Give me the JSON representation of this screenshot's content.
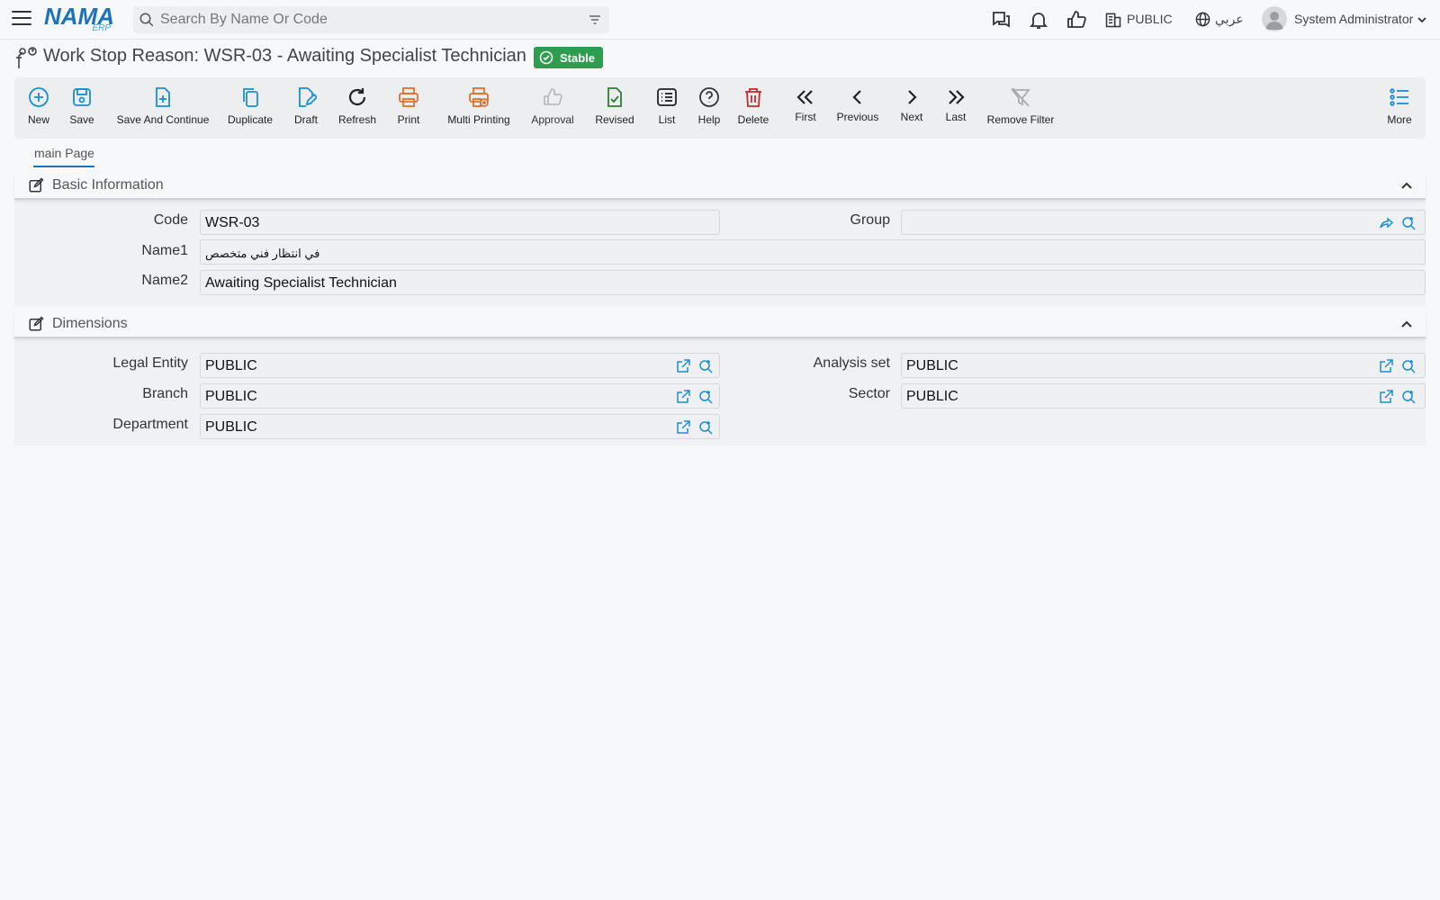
{
  "topbar": {
    "logo_main": "NAMA",
    "logo_sub": "ERP",
    "search_placeholder": "Search By Name Or Code",
    "company": "PUBLIC",
    "language": "عربي",
    "user": "System Administrator"
  },
  "header": {
    "title": "Work Stop Reason: WSR-03 - Awaiting Specialist Technician",
    "status": "Stable",
    "status_color": "#2e9d4f"
  },
  "toolbar": {
    "new": "New",
    "save": "Save",
    "save_continue": "Save And Continue",
    "duplicate": "Duplicate",
    "draft": "Draft",
    "refresh": "Refresh",
    "print": "Print",
    "multi_printing": "Multi Printing",
    "approval": "Approval",
    "revised": "Revised",
    "list": "List",
    "help": "Help",
    "delete": "Delete",
    "first": "First",
    "previous": "Previous",
    "next": "Next",
    "last": "Last",
    "remove_filter": "Remove Filter",
    "more": "More"
  },
  "tabs": {
    "main": "main Page"
  },
  "basic_info": {
    "title": "Basic Information",
    "code_label": "Code",
    "code_value": "WSR-03",
    "group_label": "Group",
    "group_value": "",
    "name1_label": "Name1",
    "name1_value": "في انتظار فني متخصص",
    "name2_label": "Name2",
    "name2_value": "Awaiting Specialist Technician"
  },
  "dimensions": {
    "title": "Dimensions",
    "legal_entity_label": "Legal Entity",
    "legal_entity_value": "PUBLIC",
    "analysis_set_label": "Analysis set",
    "analysis_set_value": "PUBLIC",
    "branch_label": "Branch",
    "branch_value": "PUBLIC",
    "sector_label": "Sector",
    "sector_value": "PUBLIC",
    "department_label": "Department",
    "department_value": "PUBLIC"
  },
  "colors": {
    "accent": "#1e73b8",
    "icon_blue": "#1a8fd0",
    "print_orange": "#e0702a",
    "revised_green": "#2e7d32",
    "delete_red": "#c62828"
  }
}
